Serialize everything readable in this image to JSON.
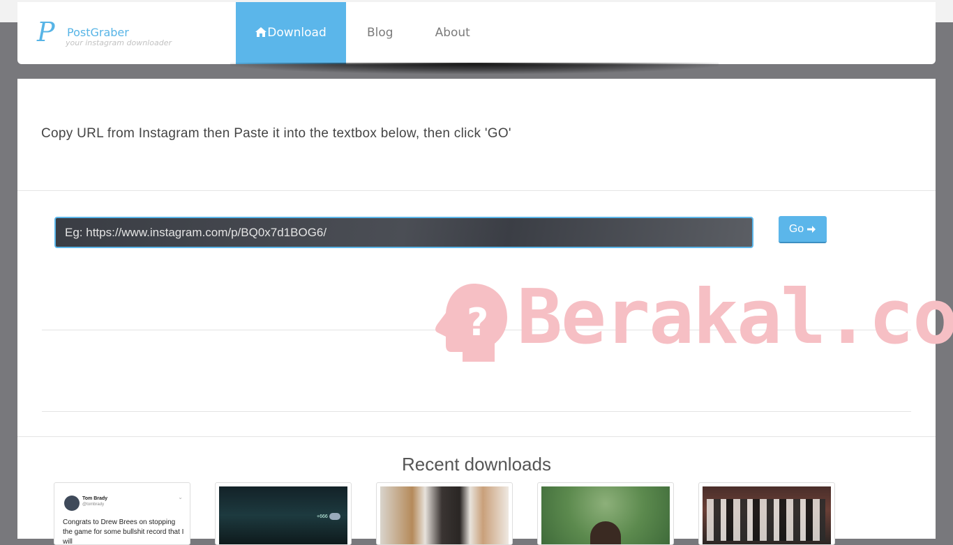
{
  "navbar": {
    "logo": {
      "letter": "P",
      "name": "PostGraber",
      "tagline": "your instagram downloader"
    },
    "items": [
      {
        "label": "Download",
        "active": true,
        "icon": "home-icon"
      },
      {
        "label": "Blog",
        "active": false
      },
      {
        "label": "About",
        "active": false
      }
    ]
  },
  "main": {
    "instruction": "Copy URL from Instagram then Paste it into the textbox below, then click 'GO'",
    "url_input": {
      "placeholder": "Eg: https://www.instagram.com/p/BQ0x7d1BOG6/",
      "value": ""
    },
    "go_button": {
      "label": "Go",
      "icon": "arrow-right-icon"
    },
    "recent_title": "Recent downloads",
    "recent": [
      {
        "type": "tweet",
        "author": "Tom Brady",
        "handle": "@tombrady",
        "text": "Congrats to Drew Brees on stopping the game for some bullshit record that I will"
      },
      {
        "type": "image",
        "overlay_text": "+666"
      },
      {
        "type": "image"
      },
      {
        "type": "image"
      },
      {
        "type": "image"
      }
    ]
  },
  "watermark": {
    "text": "Berakal.com",
    "icon": "head-question-icon"
  },
  "colors": {
    "accent": "#5bb6ea",
    "background": "#78787c",
    "watermark": "#f6bfc4"
  }
}
